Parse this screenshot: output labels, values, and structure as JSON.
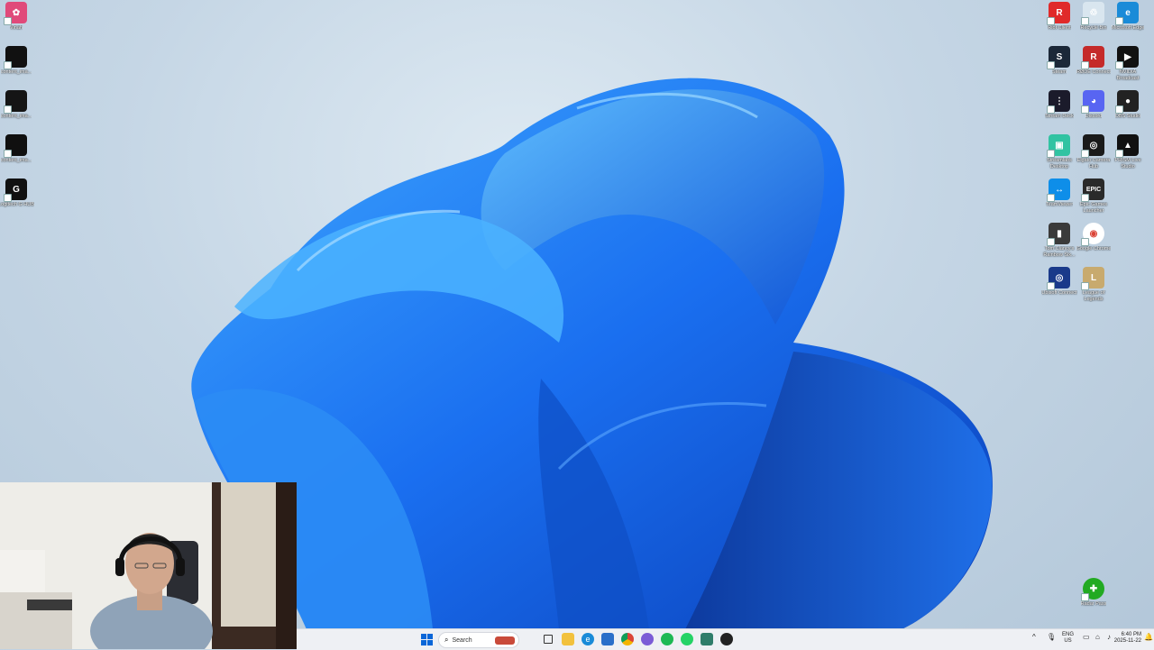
{
  "desktop_left": [
    {
      "label": "Vinah",
      "color": "#e04a7a",
      "glyph": "✿"
    },
    {
      "label": "content_ima...",
      "color": "#111111",
      "glyph": ""
    },
    {
      "label": "content_ima...",
      "color": "#151515",
      "glyph": ""
    },
    {
      "label": "content_ima...",
      "color": "#101010",
      "glyph": ""
    },
    {
      "label": "Logitech G HUB",
      "color": "#111111",
      "glyph": "G"
    }
  ],
  "desktop_right": [
    {
      "label": "Riot Client",
      "color": "#e02a2a",
      "glyph": "R"
    },
    {
      "label": "Recycle Bin",
      "color": "#d9e6ef",
      "glyph": "♲"
    },
    {
      "label": "Microsoft Edge",
      "color": "#1a8bd8",
      "glyph": "e"
    },
    {
      "label": "Steam",
      "color": "#1b2838",
      "glyph": "S"
    },
    {
      "label": "RØDE Connect",
      "color": "#c52a2a",
      "glyph": "R"
    },
    {
      "label": "NVIDIA Broadcast",
      "color": "#111111",
      "glyph": "▶"
    },
    {
      "label": "Stream Deck",
      "color": "#1b1b2b",
      "glyph": "⋮"
    },
    {
      "label": "Discord",
      "color": "#5865f2",
      "glyph": "◕"
    },
    {
      "label": "OBS Studio",
      "color": "#222222",
      "glyph": "●"
    },
    {
      "label": "Streamlabs Desktop",
      "color": "#31c3a2",
      "glyph": "▣"
    },
    {
      "label": "Elgato Camera Hub",
      "color": "#1a1a1a",
      "glyph": "◎"
    },
    {
      "label": "PRISM Live Studio",
      "color": "#111111",
      "glyph": "▲"
    },
    {
      "label": "TeamViewer",
      "color": "#0e8ee9",
      "glyph": "↔"
    },
    {
      "label": "Epic Games Launcher",
      "color": "#2a2a2a",
      "glyph": "EPIC"
    },
    {
      "label": "",
      "color": "#00000000",
      "glyph": ""
    },
    {
      "label": "Tom Clancy's Rainbow Six...",
      "color": "#3a3a3a",
      "glyph": "▮"
    },
    {
      "label": "Google Chrome",
      "color": "#ffffff",
      "glyph": "◉"
    },
    {
      "label": "",
      "color": "#00000000",
      "glyph": ""
    },
    {
      "label": "Ubisoft Connect",
      "color": "#1a3a8a",
      "glyph": "◎"
    },
    {
      "label": "League of Legends",
      "color": "#c8aa6e",
      "glyph": "L"
    }
  ],
  "desktop_extra": {
    "label": "Radar Pass",
    "color": "#22aa22",
    "glyph": "✚"
  },
  "taskbar": {
    "search_placeholder": "Search",
    "lang_top": "ENG",
    "lang_bottom": "US",
    "time": "6:40 PM",
    "date": "2025-11-22"
  },
  "colors": {
    "accent": "#0a66d8",
    "taskbar_bg": "#eef0f4"
  }
}
